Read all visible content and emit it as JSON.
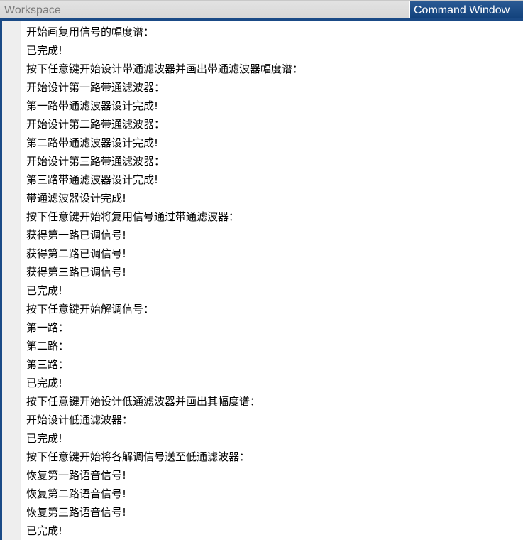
{
  "tabs": {
    "workspace": "Workspace",
    "command_window": "Command Window",
    "active": "command_window"
  },
  "colors": {
    "active_tab": "#1a4a86",
    "inactive_tab": "#d9d9d9",
    "panel_border": "#1a4a86"
  },
  "command_window": {
    "lines": [
      "开始画复用信号的幅度谱：",
      "已完成!",
      "按下任意键开始设计带通滤波器并画出带通滤波器幅度谱：",
      "开始设计第一路带通滤波器：",
      "第一路带通滤波器设计完成!",
      "开始设计第二路带通滤波器：",
      "第二路带通滤波器设计完成!",
      "开始设计第三路带通滤波器：",
      "第三路带通滤波器设计完成!",
      "带通滤波器设计完成!",
      "按下任意键开始将复用信号通过带通滤波器：",
      "获得第一路已调信号!",
      "获得第二路已调信号!",
      "获得第三路已调信号!",
      "已完成!",
      "按下任意键开始解调信号：",
      "第一路：",
      "第二路：",
      "第三路：",
      "已完成!",
      "按下任意键开始设计低通滤波器并画出其幅度谱：",
      "开始设计低通滤波器：",
      "已完成!",
      "按下任意键开始将各解调信号送至低通滤波器：",
      "恢复第一路语音信号!",
      "恢复第二路语音信号!",
      "恢复第三路语音信号!",
      "已完成!"
    ]
  }
}
